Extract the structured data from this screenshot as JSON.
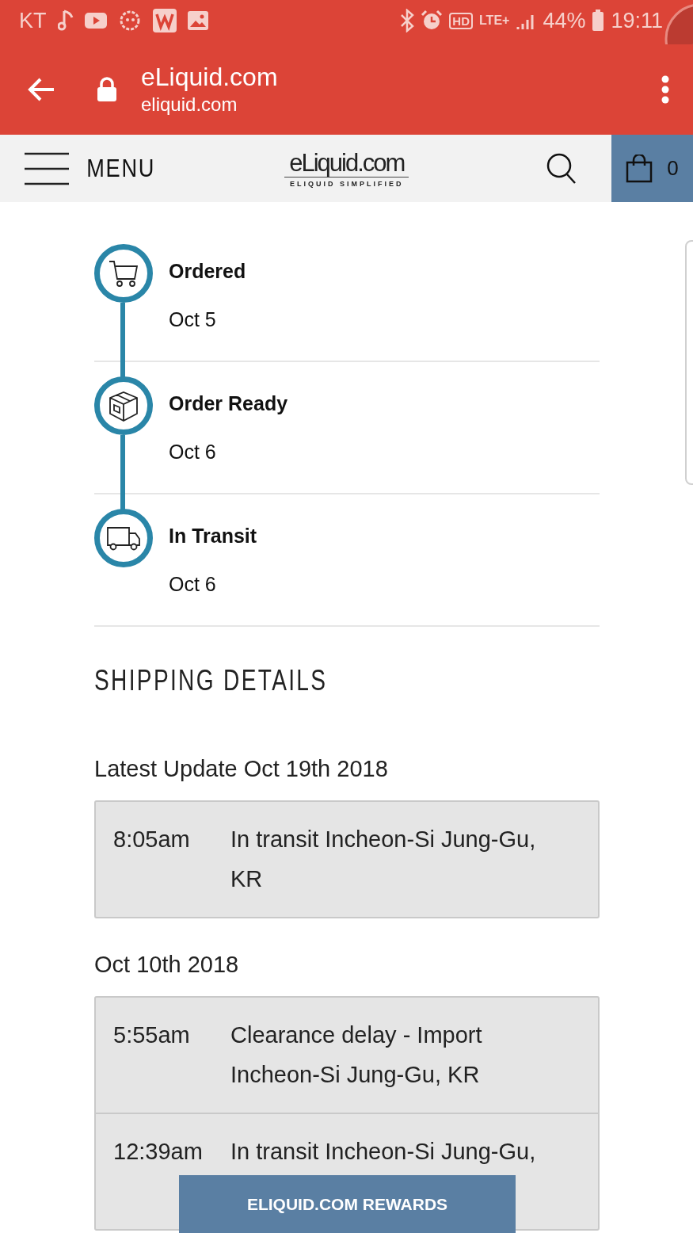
{
  "status_bar": {
    "carrier": "KT",
    "hd": "HD",
    "network": "LTE+",
    "battery": "44%",
    "time": "19:11"
  },
  "browser": {
    "title": "eLiquid.com",
    "url": "eliquid.com"
  },
  "site_header": {
    "menu_label": "MENU",
    "logo": "eLiquid.com",
    "tagline": "ELIQUID SIMPLIFIED",
    "cart_count": "0"
  },
  "timeline": [
    {
      "kind": "cart",
      "title": "Ordered",
      "date": "Oct 5"
    },
    {
      "kind": "box",
      "title": "Order Ready",
      "date": "Oct 6"
    },
    {
      "kind": "truck",
      "title": "In Transit",
      "date": "Oct 6"
    }
  ],
  "shipping": {
    "heading": "SHIPPING DETAILS",
    "groups": [
      {
        "date": "Latest Update Oct 19th 2018",
        "events": [
          {
            "time": "8:05am",
            "description": "In transit Incheon-Si Jung-Gu, KR"
          }
        ]
      },
      {
        "date": "Oct 10th 2018",
        "events": [
          {
            "time": "5:55am",
            "description": "Clearance delay - Import Incheon-Si Jung-Gu, KR"
          },
          {
            "time": "12:39am",
            "description": "In transit Incheon-Si Jung-Gu,"
          }
        ]
      }
    ]
  },
  "rewards_button": "ELIQUID.COM REWARDS"
}
